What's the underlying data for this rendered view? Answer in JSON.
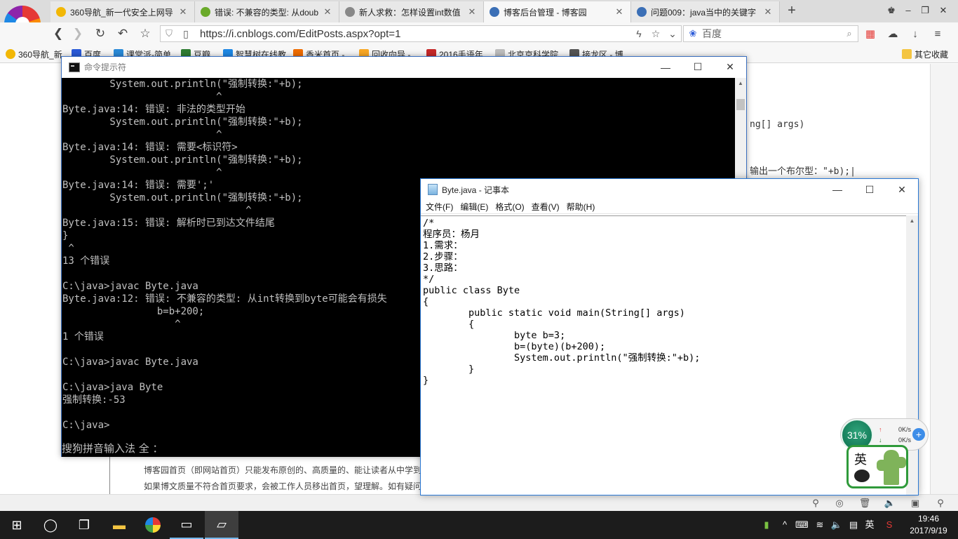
{
  "browser": {
    "tabs": [
      {
        "title": "360导航_新一代安全上网导",
        "favicon_color": "#f2b705"
      },
      {
        "title": "错误: 不兼容的类型: 从doub",
        "favicon_color": "#6aaa2a"
      },
      {
        "title": "新人求救：怎样设置int数值",
        "favicon_color": "#666666"
      },
      {
        "title": "博客后台管理 - 博客园",
        "favicon_color": "#3b6fb6"
      },
      {
        "title": "问题009：java当中的关键字",
        "favicon_color": "#3b6fb6"
      }
    ],
    "url": "https://i.cnblogs.com/EditPosts.aspx?opt=1",
    "search_placeholder": "百度",
    "bookmarks": [
      {
        "label": "360导航_新",
        "color": "#f2b705"
      },
      {
        "label": "百度",
        "color": "#2a5ad8"
      },
      {
        "label": "课堂派-简单",
        "color": "#2a8ad8"
      },
      {
        "label": "豆瓣",
        "color": "#2e7d32"
      },
      {
        "label": "智慧树在线教",
        "color": "#1e88e5"
      },
      {
        "label": "香米首页 -",
        "color": "#ef6c00"
      },
      {
        "label": "回收向导 -",
        "color": "#f9a825"
      },
      {
        "label": "2016手语年",
        "color": "#c62828"
      },
      {
        "label": "北京京科学院",
        "color": "#9e9e9e"
      },
      {
        "label": "接龙区 - 博",
        "color": "#555555"
      }
    ],
    "bookmarks_other": "其它收藏"
  },
  "page": {
    "peek_code_1": "ng[] args)",
    "peek_code_2": "输出一个布尔型：\"+b);|",
    "line_1": "博客园首页（即网站首页）只能发布原创的、高质量的、能让读者从中学到",
    "line_2": "如果博文质量不符合首页要求，会被工作人员移出首页，望理解。如有疑问"
  },
  "cmd": {
    "title": "命令提示符",
    "lines": "        System.out.println(\"强制转换:\"+b);\n                          ^\nByte.java:14: 错误: 非法的类型开始\n        System.out.println(\"强制转换:\"+b);\n                          ^\nByte.java:14: 错误: 需要<标识符>\n        System.out.println(\"强制转换:\"+b);\n                          ^\nByte.java:14: 错误: 需要';'\n        System.out.println(\"强制转换:\"+b);\n                               ^\nByte.java:15: 错误: 解析时已到达文件结尾\n}\n ^\n13 个错误\n\nC:\\java>javac Byte.java\nByte.java:12: 错误: 不兼容的类型: 从int转换到byte可能会有损失\n                b=b+200;\n                   ^\n1 个错误\n\nC:\\java>javac Byte.java\n\nC:\\java>java Byte\n强制转换:-53\n\nC:\\java>",
    "ime_status": "搜狗拼音输入法 全 ："
  },
  "notepad": {
    "title": "Byte.java - 记事本",
    "menu": [
      "文件(F)",
      "编辑(E)",
      "格式(O)",
      "查看(V)",
      "帮助(H)"
    ],
    "content": "/*\n程序员：杨月\n1.需求：\n2.步骤：\n3.思路：\n*/\npublic class Byte\n{\n        public static void main(String[] args)\n        {\n                byte b=3;\n                b=(byte)(b+200);\n                System.out.println(\"强制转换:\"+b);\n        }\n}"
  },
  "widgets": {
    "cpu_percent": "31%",
    "upload_speed": "0K/s",
    "download_speed": "0K/s",
    "ime_label": "英"
  },
  "taskbar": {
    "time": "19:46",
    "date": "2017/9/19",
    "ime_indicator": "英"
  }
}
